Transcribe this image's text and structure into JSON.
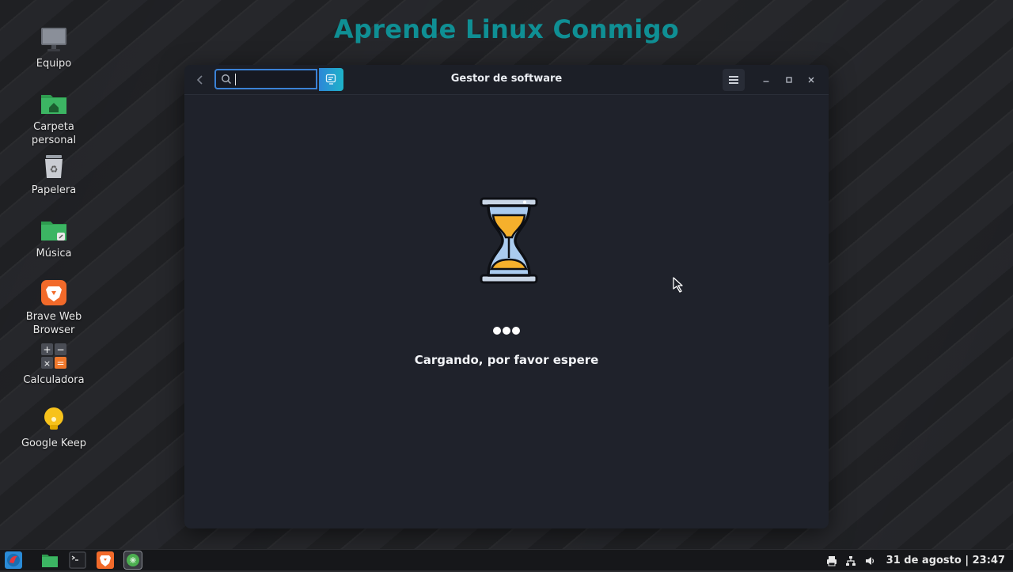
{
  "desktop": {
    "brand_title": "Aprende Linux Conmigo",
    "icons": [
      {
        "label": "Equipo",
        "icon": "computer-icon"
      },
      {
        "label": "Carpeta personal",
        "icon": "home-folder-icon"
      },
      {
        "label": "Papelera",
        "icon": "trash-icon"
      },
      {
        "label": "Música",
        "icon": "music-folder-icon"
      },
      {
        "label": "Brave Web Browser",
        "icon": "brave-icon"
      },
      {
        "label": "Calculadora",
        "icon": "calculator-icon"
      },
      {
        "label": "Google Keep",
        "icon": "keep-icon"
      }
    ]
  },
  "window": {
    "title": "Gestor de software",
    "search": {
      "value": "",
      "placeholder": ""
    },
    "loading_text": "Cargando, por favor espere"
  },
  "taskbar": {
    "apps": [
      "menu-icon",
      "files-icon",
      "terminal-icon",
      "brave-icon",
      "software-manager-icon"
    ],
    "clock": "31 de agosto | 23:47"
  },
  "colors": {
    "brand": "#0f8f94",
    "accent": "#3b82d6",
    "hourglass_sand": "#f5b02c"
  }
}
